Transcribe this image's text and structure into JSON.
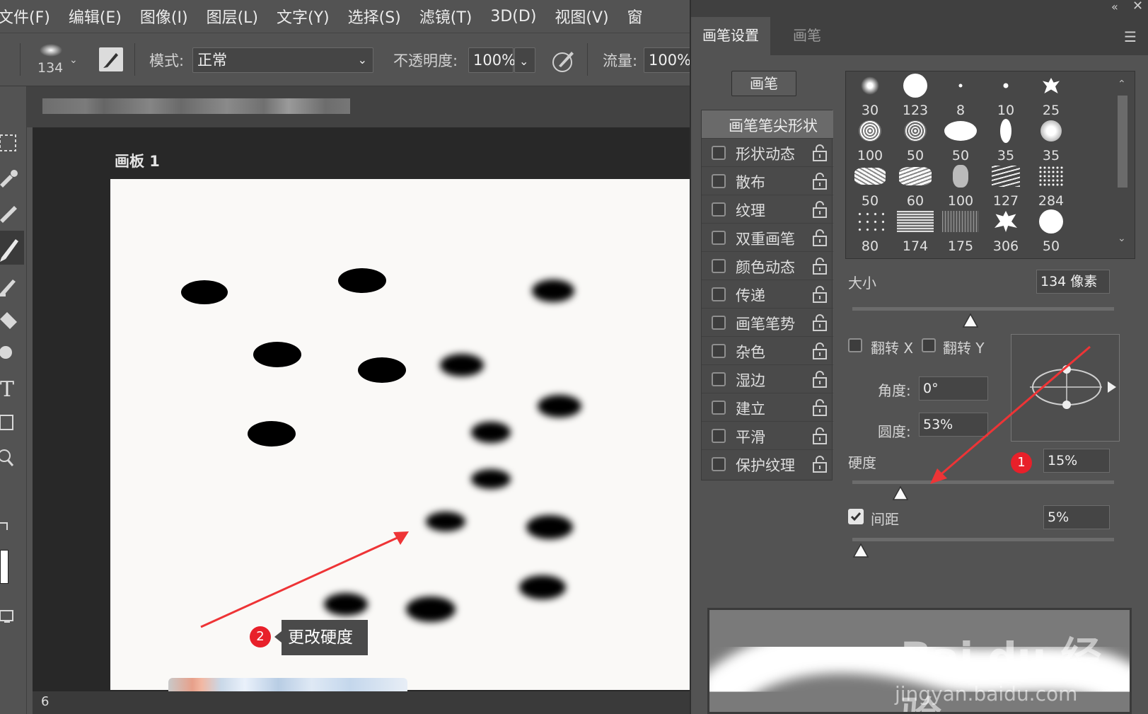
{
  "menubar": {
    "items": [
      "文件(F)",
      "编辑(E)",
      "图像(I)",
      "图层(L)",
      "文字(Y)",
      "选择(S)",
      "滤镜(T)",
      "3D(D)",
      "视图(V)",
      "窗"
    ]
  },
  "options_bar": {
    "brush_size": "134",
    "mode_label": "模式:",
    "mode_value": "正常",
    "opacity_label": "不透明度:",
    "opacity_value": "100%",
    "flow_label": "流量:",
    "flow_value": "100%"
  },
  "document": {
    "artboard_label": "画板 1",
    "status_text": "6"
  },
  "annotations": {
    "callout_2_badge": "2",
    "callout_2_text": "更改硬度",
    "callout_1_badge": "1",
    "arrow_color": "#ee3436"
  },
  "panel": {
    "tabs": [
      "画笔设置",
      "画笔"
    ],
    "brush_button": "画笔",
    "options": [
      {
        "label": "画笔笔尖形状",
        "header": true
      },
      {
        "label": "形状动态",
        "checked": false
      },
      {
        "label": "散布",
        "checked": false
      },
      {
        "label": "纹理",
        "checked": false
      },
      {
        "label": "双重画笔",
        "checked": false
      },
      {
        "label": "颜色动态",
        "checked": false
      },
      {
        "label": "传递",
        "checked": false
      },
      {
        "label": "画笔笔势",
        "checked": false
      },
      {
        "label": "杂色",
        "checked": false
      },
      {
        "label": "湿边",
        "checked": false
      },
      {
        "label": "建立",
        "checked": false
      },
      {
        "label": "平滑",
        "checked": false
      },
      {
        "label": "保护纹理",
        "checked": false
      }
    ],
    "presets": [
      [
        "30",
        "123",
        "8",
        "10",
        "25"
      ],
      [
        "100",
        "50",
        "50",
        "35",
        "35"
      ],
      [
        "50",
        "60",
        "100",
        "127",
        "284"
      ],
      [
        "80",
        "174",
        "175",
        "306",
        "50"
      ]
    ],
    "size_label": "大小",
    "size_value": "134 像素",
    "size_fraction": 0.42,
    "flip_x_label": "翻转 X",
    "flip_y_label": "翻转 Y",
    "angle_label": "角度:",
    "angle_value": "0°",
    "roundness_label": "圆度:",
    "roundness_value": "53%",
    "hardness_label": "硬度",
    "hardness_value": "15%",
    "hardness_fraction": 0.15,
    "spacing_label": "间距",
    "spacing_value": "5%",
    "spacing_checked": true,
    "spacing_fraction": 0.0
  },
  "watermark": {
    "brand": "Bai du 经验",
    "url": "jingyan.baidu.com"
  }
}
